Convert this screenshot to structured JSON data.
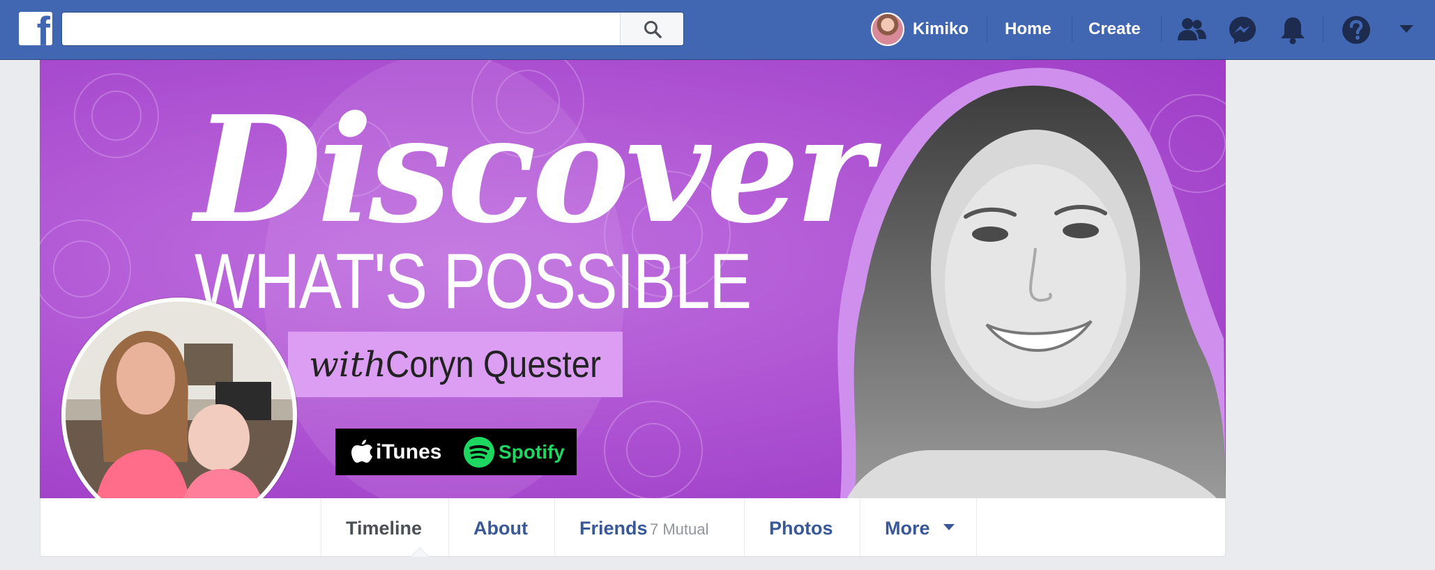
{
  "topbar": {
    "logo_letter": "f",
    "search_value": "",
    "user_name": "Kimiko",
    "home_label": "Home",
    "create_label": "Create",
    "icons": [
      "search-icon",
      "friend-requests-icon",
      "messenger-icon",
      "notifications-icon",
      "help-icon",
      "account-menu-caret-icon"
    ],
    "brand_color": "#4267b2"
  },
  "cover": {
    "headline": "Discover",
    "subheadline": "WHAT'S POSSIBLE",
    "with_text": "with",
    "host_name": "Coryn Quester",
    "itunes_label": "iTunes",
    "spotify_label": "Spotify",
    "background_color": "#b056d4",
    "accent_color": "#dc9ef2",
    "spotify_color": "#1ed760"
  },
  "tabs": {
    "timeline": "Timeline",
    "about": "About",
    "friends": "Friends",
    "friends_sub": "7 Mutual",
    "photos": "Photos",
    "more": "More",
    "active": "Timeline"
  }
}
